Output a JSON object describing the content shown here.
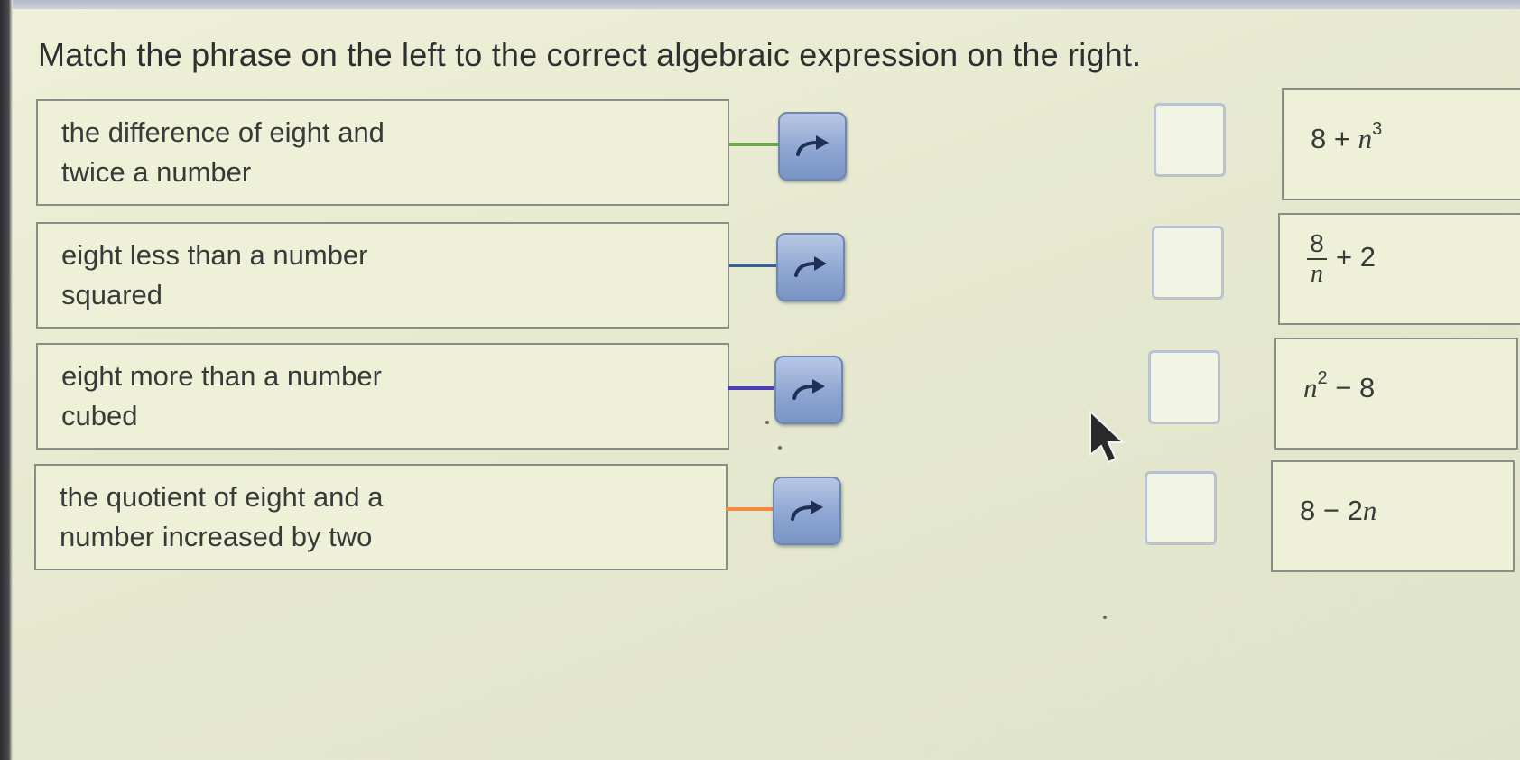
{
  "instructions": "Match the phrase on the left to the correct algebraic expression on the right.",
  "phrases": [
    {
      "text": "the difference of eight and twice a number",
      "connector_color": "#6aa84f"
    },
    {
      "text": "eight less than a number squared",
      "connector_color": "#3d5f8c"
    },
    {
      "text": "eight more than a number cubed",
      "connector_color": "#4b3fb3"
    },
    {
      "text": "the quotient of eight and a number increased by two",
      "connector_color": "#f08a3c"
    }
  ],
  "expressions": [
    {
      "base": "8 +",
      "var": "n",
      "exp": "3"
    },
    {
      "numerator": "8",
      "denominator": "n",
      "rest": "+ 2"
    },
    {
      "var": "n",
      "exp": "2",
      "rest": "− 8"
    },
    {
      "lead": "8 − 2",
      "var": "n"
    }
  ],
  "icons": {
    "match_button": "curved-arrow-right-icon",
    "pointer": "mouse-cursor-icon"
  },
  "colors": {
    "button_fill": "#8ea6d2",
    "drop_border": "#b8c3cf",
    "background": "#e6e9cf"
  }
}
